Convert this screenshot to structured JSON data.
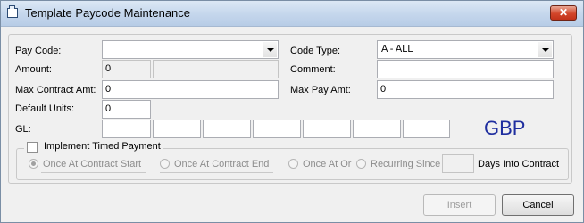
{
  "window": {
    "title": "Template Paycode Maintenance",
    "close_glyph": "✕"
  },
  "form": {
    "pay_code": {
      "label": "Pay Code:",
      "value": ""
    },
    "code_type": {
      "label": "Code Type:",
      "value": "A - ALL"
    },
    "amount": {
      "label": "Amount:",
      "value": "0",
      "extra": ""
    },
    "comment": {
      "label": "Comment:",
      "value": ""
    },
    "max_contract_amt": {
      "label": "Max Contract Amt:",
      "value": "0"
    },
    "max_pay_amt": {
      "label": "Max Pay Amt:",
      "value": "0"
    },
    "default_units": {
      "label": "Default Units:",
      "value": "0"
    },
    "gl": {
      "label": "GL:",
      "segments": [
        "",
        "",
        "",
        "",
        "",
        "",
        ""
      ]
    },
    "currency": "GBP"
  },
  "timed_payment": {
    "label": "Implement Timed Payment",
    "checked": false,
    "options": [
      "Once At Contract Start",
      "Once At Contract End",
      "Once At Or",
      "Recurring Since"
    ],
    "days_value": "",
    "days_label": "Days Into Contract"
  },
  "buttons": {
    "insert": "Insert",
    "cancel": "Cancel"
  }
}
